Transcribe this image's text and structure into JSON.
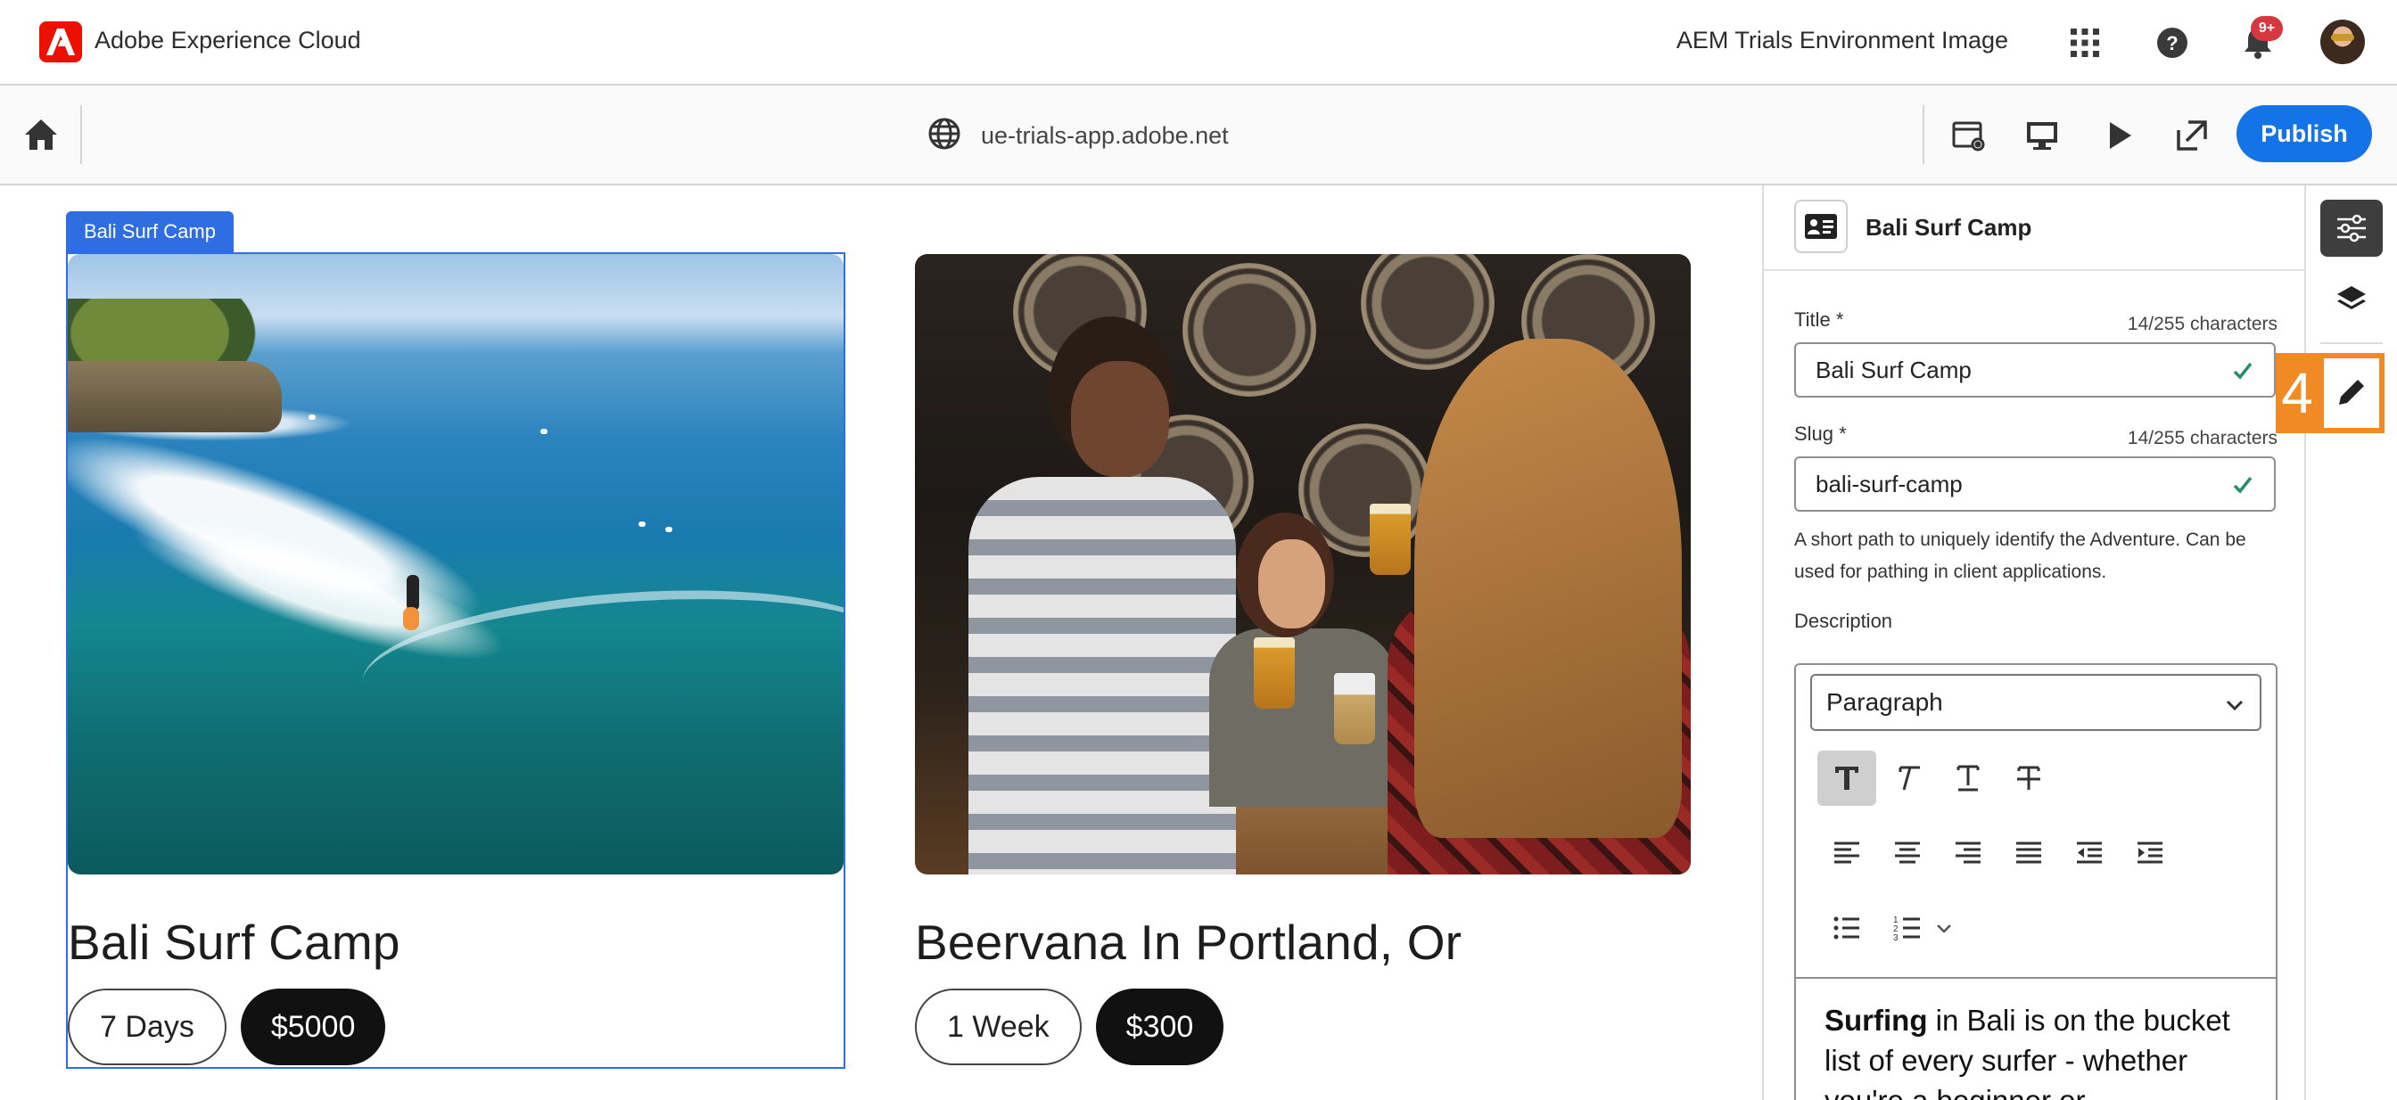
{
  "shell": {
    "app_name": "Adobe Experience Cloud",
    "environment": "AEM Trials Environment Image",
    "notification_count": "9+",
    "icons": [
      "adobe-logo-icon",
      "app-switcher-icon",
      "help-icon",
      "bell-icon"
    ]
  },
  "toolbar": {
    "url": "ue-trials-app.adobe.net",
    "publish_label": "Publish",
    "icons": [
      "home-icon",
      "globe-icon",
      "properties-view-icon",
      "desktop-emulator-icon",
      "preview-play-icon",
      "open-in-new-icon"
    ]
  },
  "canvas": {
    "selected_label": "Bali Surf Camp",
    "cards": [
      {
        "title": "Bali Surf Camp",
        "duration": "7 Days",
        "price": "$5000"
      },
      {
        "title": "Beervana In Portland, Or",
        "duration": "1 Week",
        "price": "$300"
      }
    ]
  },
  "panel": {
    "component_name": "Bali Surf Camp",
    "title_field": {
      "label": "Title",
      "required_mark": "*",
      "count": "14/255 characters",
      "value": "Bali Surf Camp"
    },
    "slug_field": {
      "label": "Slug",
      "required_mark": "*",
      "count": "14/255 characters",
      "value": "bali-surf-camp"
    },
    "slug_help": "A short path to uniquely identify the Adventure. Can be used for pathing in client applications.",
    "description_label": "Description",
    "rte": {
      "block_format": "Paragraph",
      "body_bold": "Surfing",
      "body_rest": " in Bali is on the bucket list of every surfer - whether you're a beginner or"
    }
  },
  "rail": {
    "step_number": "4",
    "icons": [
      "properties-sliders-icon",
      "layers-icon",
      "edit-pencil-icon"
    ]
  },
  "colors": {
    "accent": "#1473e6",
    "selection": "#2f6ee2",
    "highlight": "#f08a24",
    "adobe_red": "#eb1000"
  }
}
